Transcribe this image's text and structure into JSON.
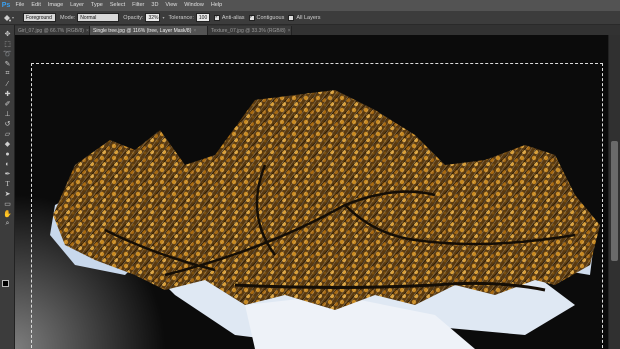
{
  "app": {
    "logo": "Ps"
  },
  "menu": [
    "File",
    "Edit",
    "Image",
    "Layer",
    "Type",
    "Select",
    "Filter",
    "3D",
    "View",
    "Window",
    "Help"
  ],
  "options": {
    "fill_source": "Foreground",
    "mode_label": "Mode:",
    "mode_value": "Normal",
    "opacity_label": "Opacity:",
    "opacity_value": "32%",
    "tolerance_label": "Tolerance:",
    "tolerance_value": "100",
    "anti_alias_label": "Anti-alias",
    "anti_alias_checked": true,
    "contiguous_label": "Contiguous",
    "contiguous_checked": true,
    "all_layers_label": "All Layers",
    "all_layers_checked": false
  },
  "tabs": [
    {
      "label": "Girl_07.jpg @ 66.7% (RGB/8)",
      "active": false
    },
    {
      "label": "Single tree.jpg @ 116% (tree, Layer Mask/8)",
      "active": true
    },
    {
      "label": "Texture_07.jpg @ 33.3% (RGB/8)",
      "active": false
    }
  ],
  "tools": [
    "move-icon",
    "marquee-icon",
    "lasso-icon",
    "quick-select-icon",
    "crop-icon",
    "eyedropper-icon",
    "healing-icon",
    "brush-icon",
    "clone-stamp-icon",
    "history-brush-icon",
    "eraser-icon",
    "paint-bucket-icon",
    "blur-icon",
    "dodge-icon",
    "pen-icon",
    "type-icon",
    "path-select-icon",
    "rectangle-icon",
    "hand-icon",
    "zoom-icon"
  ],
  "colors": {
    "foreground": "#000000",
    "background": "#ffffff",
    "menubar": "#535353",
    "canvas": "#0b0b0b"
  }
}
